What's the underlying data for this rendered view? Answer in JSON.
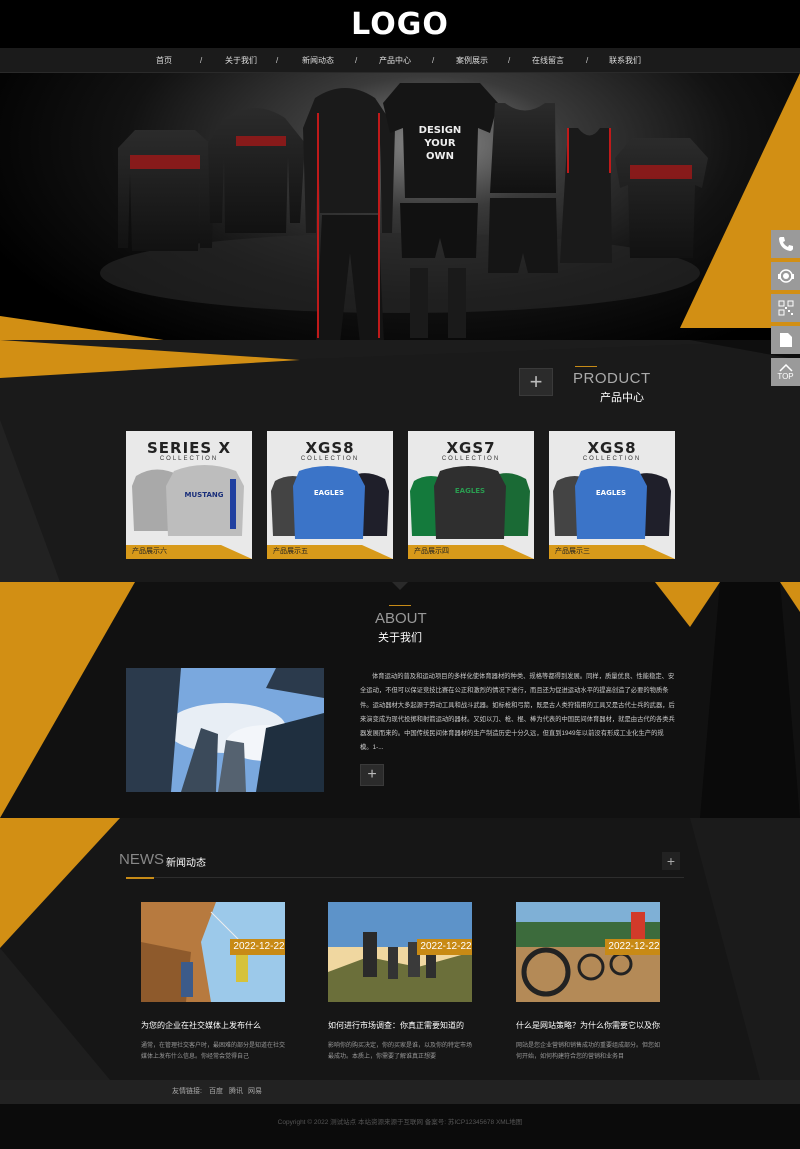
{
  "header": {
    "logo": "LOGO"
  },
  "nav": {
    "items": [
      "首页",
      "关于我们",
      "新闻动态",
      "产品中心",
      "案例展示",
      "在线留言",
      "联系我们"
    ],
    "separator": "/"
  },
  "banner": {
    "jersey_text": [
      "DESIGN",
      "YOUR",
      "OWN"
    ],
    "slides": 2,
    "active_slide": 1
  },
  "side_tools": {
    "top_label": "TOP",
    "icons": [
      "phone-icon",
      "customer-service-icon",
      "qrcode-icon",
      "document-icon",
      "top-arrow-icon"
    ]
  },
  "products": {
    "title_en": "PRODUCT",
    "title_cn": "产品中心",
    "more": "+",
    "items": [
      {
        "brand": "SERIES X",
        "sub": "COLLECTION",
        "print": "MUSTANG",
        "caption": "产品展示六"
      },
      {
        "brand": "XGS8",
        "sub": "COLLECTION",
        "print": "EAGLES",
        "caption": "产品展示五"
      },
      {
        "brand": "XGS7",
        "sub": "COLLECTION",
        "print": "EAGLES",
        "caption": "产品展示四"
      },
      {
        "brand": "XGS8",
        "sub": "COLLECTION",
        "print": "EAGLES",
        "caption": "产品展示三"
      }
    ]
  },
  "about": {
    "title_en": "ABOUT",
    "title_cn": "关于我们",
    "more": "+",
    "text": "体育运动的普及和运动项目的多样化使体育器材的种类、规格等都得到发展。同样，质量优良、性能稳定、安全运动，不但可以保证竞技比赛在公正和激烈的情况下进行，而且还为促进运动水平的提高创造了必要的物质条件。运动器材大多起源于劳动工具和战斗武器。如标枪和弓箭，既是古人类狩猎用的工具又是古代士兵的武器，后来演变成为现代投掷和射箭运动的器材。又如以刀、枪、棍、棒为代表的中国民间体育器材，就是由古代的各类兵器发展而来的。中国传统民间体育器材的生产制造历史十分久远，但直到1949年以前没有形成工业化生产的规模。1-..."
  },
  "news": {
    "title_en": "NEWS",
    "title_cn": "新闻动态",
    "more": "+",
    "items": [
      {
        "date": "2022-12-22",
        "title": "为您的企业在社交媒体上发布什么",
        "desc": "通常，在管理社交客户时，最困难的部分是知道在社交媒体上发布什么信息。你经常会觉得自己"
      },
      {
        "date": "2022-12-22",
        "title": "如何进行市场调查：你真正需要知道的",
        "desc": "影响你的购买决定，你的买家是谁，以及你的特定市场最成功。本质上，你需要了解谁真正想要"
      },
      {
        "date": "2022-12-22",
        "title": "什么是网站策略？为什么你需要它以及你",
        "desc": "网站是您企业营销和销售成功的重要组成部分。但您如何开始，如何构建符合您的营销和业务目"
      }
    ]
  },
  "footer": {
    "links_label": "友情链接:",
    "links": [
      "百度",
      "腾讯",
      "网易"
    ],
    "copyright": "Copyright © 2022 测试站点 本站资源来源于互联网 备案号: 苏ICP12345678 XML地图"
  },
  "colors": {
    "accent": "#c88a15",
    "dark": "#111111"
  }
}
